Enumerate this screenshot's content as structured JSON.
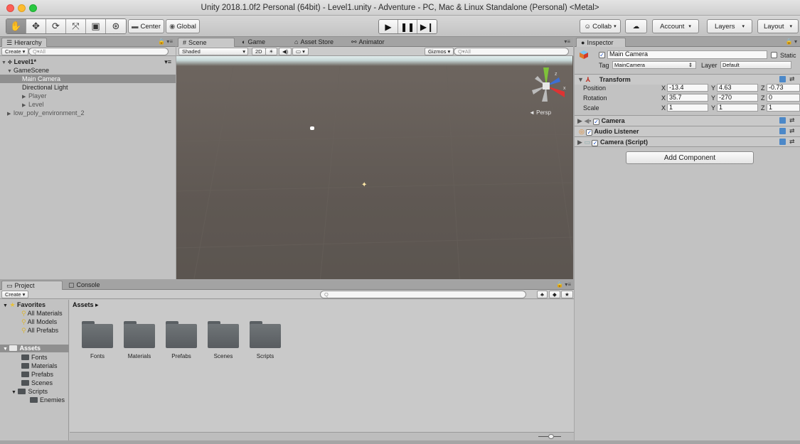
{
  "window": {
    "title": "Unity 2018.1.0f2 Personal (64bit) - Level1.unity - Adventure - PC, Mac & Linux Standalone (Personal) <Metal>"
  },
  "toolbar": {
    "tools": [
      "hand-icon",
      "move-icon",
      "rotate-icon",
      "scale-icon",
      "rect-icon",
      "transform-icon"
    ],
    "pivot_label": "Center",
    "space_label": "Global",
    "collab_label": "Collab",
    "account_label": "Account",
    "layers_label": "Layers",
    "layout_label": "Layout"
  },
  "hierarchy": {
    "tab": "Hierarchy",
    "create_label": "Create",
    "search_placeholder": "Q▾All",
    "scene_name": "Level1*",
    "items": [
      {
        "label": "GameScene",
        "depth": 1,
        "arrow": "▼"
      },
      {
        "label": "Main Camera",
        "depth": 2,
        "arrow": "",
        "selected": true
      },
      {
        "label": "Directional Light",
        "depth": 2,
        "arrow": ""
      },
      {
        "label": "Player",
        "depth": 2,
        "arrow": "▶"
      },
      {
        "label": "Level",
        "depth": 2,
        "arrow": "▶"
      },
      {
        "label": "low_poly_environment_2",
        "depth": 1,
        "arrow": "▶"
      }
    ]
  },
  "scene": {
    "tabs": [
      "Scene",
      "Game",
      "Asset Store",
      "Animator"
    ],
    "shading": "Shaded",
    "mode_2d": "2D",
    "gizmos_label": "Gizmos",
    "search_placeholder": "Q▾All",
    "persp_label": "◄ Persp",
    "axis_y": "y",
    "axis_x": "x",
    "axis_z": "z"
  },
  "inspector": {
    "tab": "Inspector",
    "object_name": "Main Camera",
    "static_label": "Static",
    "tag_label": "Tag",
    "tag_value": "MainCamera",
    "layer_label": "Layer",
    "layer_value": "Default",
    "transform": {
      "title": "Transform",
      "position": {
        "label": "Position",
        "x": "-13.4",
        "y": "4.63",
        "z": "-0.73"
      },
      "rotation": {
        "label": "Rotation",
        "x": "35.7",
        "y": "-270",
        "z": "0"
      },
      "scale": {
        "label": "Scale",
        "x": "1",
        "y": "1",
        "z": "1"
      }
    },
    "components": [
      "Camera",
      "Audio Listener",
      "Camera (Script)"
    ],
    "add_component_label": "Add Component",
    "axis_labels": {
      "x": "X",
      "y": "Y",
      "z": "Z"
    }
  },
  "project": {
    "tabs": [
      "Project",
      "Console"
    ],
    "create_label": "Create",
    "favorites_label": "Favorites",
    "favorites": [
      "All Materials",
      "All Models",
      "All Prefabs"
    ],
    "assets_label": "Assets",
    "assets_tree": [
      {
        "label": "Fonts",
        "depth": 1
      },
      {
        "label": "Materials",
        "depth": 1
      },
      {
        "label": "Prefabs",
        "depth": 1
      },
      {
        "label": "Scenes",
        "depth": 1
      },
      {
        "label": "Scripts",
        "depth": 1,
        "arrow": "▼"
      },
      {
        "label": "Enemies",
        "depth": 2
      }
    ],
    "breadcrumb": "Assets ▸",
    "folders": [
      "Fonts",
      "Materials",
      "Prefabs",
      "Scenes",
      "Scripts"
    ]
  },
  "colors": {
    "selection": "#8f8f8f",
    "scene_ground": "#5f5853",
    "sky": "#c8d8d8"
  }
}
